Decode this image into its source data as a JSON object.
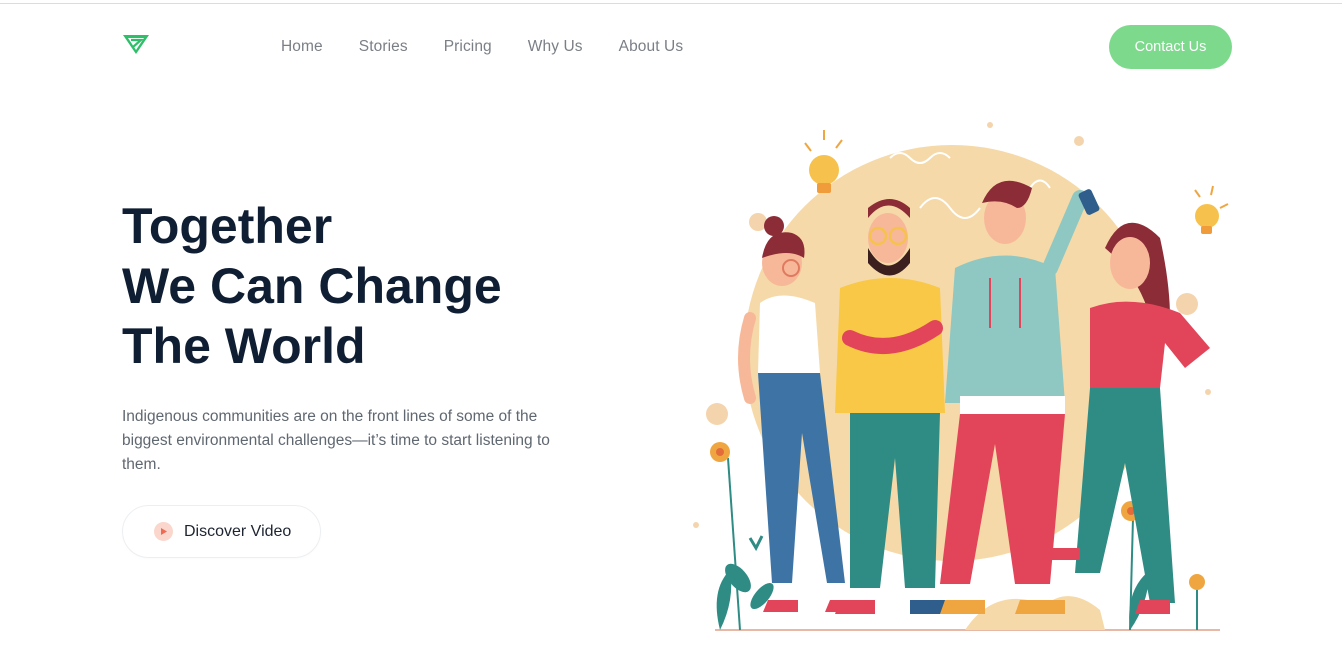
{
  "brand": {
    "logo_icon": "triangle-logo-icon",
    "accent": "#7dd98c"
  },
  "nav": {
    "items": [
      {
        "label": "Home"
      },
      {
        "label": "Stories"
      },
      {
        "label": "Pricing"
      },
      {
        "label": "Why Us"
      },
      {
        "label": "About Us"
      }
    ],
    "contact_label": "Contact Us"
  },
  "hero": {
    "title_lines": [
      "Together",
      "We Can Change",
      "The World"
    ],
    "description": "Indigenous communities are on the front lines of some of the biggest environmental challenges—it’s time to start listening to them.",
    "video_button": {
      "label": "Discover Video",
      "icon": "play-icon"
    },
    "title_color": "#0f1e32"
  },
  "illustration": {
    "name": "group-of-young-people-illustration",
    "circle_color": "#f6d9a8"
  }
}
